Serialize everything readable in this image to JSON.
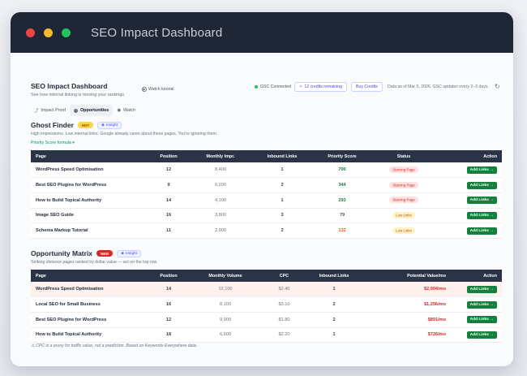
{
  "window": {
    "title": "SEO Impact Dashboard"
  },
  "header": {
    "title": "SEO Impact Dashboard",
    "subtitle": "See how internal linking is moving your rankings",
    "tutorial": "Watch tutorial",
    "gsc": "GSC Connected",
    "credits": "12 credits remaining",
    "buy": "Buy Credits",
    "data_as": "Data as of Mar 5, 2026. GSC updates every 2–3 days."
  },
  "tabs": [
    {
      "label": "Impact Proof",
      "icon": "trend-icon"
    },
    {
      "label": "Opportunities",
      "icon": "dot-icon"
    },
    {
      "label": "Watch",
      "icon": "eye-icon"
    }
  ],
  "ghost": {
    "title": "Ghost Finder",
    "badge": "HOT",
    "insight": "Insight",
    "desc": "High impressions. Low internal links. Google already cares about these pages. You're ignoring them.",
    "formula": "Priority Score formula ▾",
    "columns": [
      "Page",
      "Position",
      "Monthly Impr.",
      "Inbound Links",
      "Priority Score",
      "Status",
      "Action"
    ],
    "rows": [
      {
        "page": "WordPress Speed Optimisation",
        "position": "12",
        "impr": "8,400",
        "links": "1",
        "score": "700",
        "score_color": "#15803d",
        "status": "Starving Page",
        "status_type": "starving",
        "action": "Add Links →"
      },
      {
        "page": "Best SEO Plugins for WordPress",
        "position": "9",
        "impr": "6,200",
        "links": "2",
        "score": "344",
        "score_color": "#15803d",
        "status": "Starving Page",
        "status_type": "starving",
        "action": "Add Links →"
      },
      {
        "page": "How to Build Topical Authority",
        "position": "14",
        "impr": "4,100",
        "links": "1",
        "score": "293",
        "score_color": "#15803d",
        "status": "Starving Page",
        "status_type": "starving",
        "action": "Add Links →"
      },
      {
        "page": "Image SEO Guide",
        "position": "16",
        "impr": "3,800",
        "links": "3",
        "score": "79",
        "score_color": "#4b5563",
        "status": "Low Links",
        "status_type": "low",
        "action": "Add Links →"
      },
      {
        "page": "Schema Markup Tutorial",
        "position": "11",
        "impr": "2,900",
        "links": "2",
        "score": "132",
        "score_color": "#ea580c",
        "status": "Low Links",
        "status_type": "low",
        "action": "Add Links →"
      }
    ]
  },
  "opportunity": {
    "title": "Opportunity Matrix",
    "badge": "NEW",
    "insight": "Insight",
    "desc": "Striking distance pages ranked by dollar value — act on the top row.",
    "columns": [
      "Page",
      "Position",
      "Monthly Volume",
      "CPC",
      "Inbound Links",
      "Potential Value/mo",
      "Action"
    ],
    "rows": [
      {
        "page": "WordPress Speed Optimisation",
        "position": "14",
        "volume": "12,100",
        "cpc": "$2.40",
        "links": "1",
        "value": "$2,904/mo",
        "action": "Add Links →"
      },
      {
        "page": "Local SEO for Small Business",
        "position": "16",
        "volume": "8,100",
        "cpc": "$3.10",
        "links": "2",
        "value": "$1,256/mo",
        "action": "Add Links →"
      },
      {
        "page": "Best SEO Plugins for WordPress",
        "position": "12",
        "volume": "9,900",
        "cpc": "$1.80",
        "links": "2",
        "value": "$891/mo",
        "action": "Add Links →"
      },
      {
        "page": "How to Build Topical Authority",
        "position": "18",
        "volume": "6,600",
        "cpc": "$2.20",
        "links": "1",
        "value": "$726/mo",
        "action": "Add Links →"
      }
    ],
    "footnote": "⚠ CPC is a proxy for traffic value, not a prediction. Based on Keywords Everywhere data."
  }
}
